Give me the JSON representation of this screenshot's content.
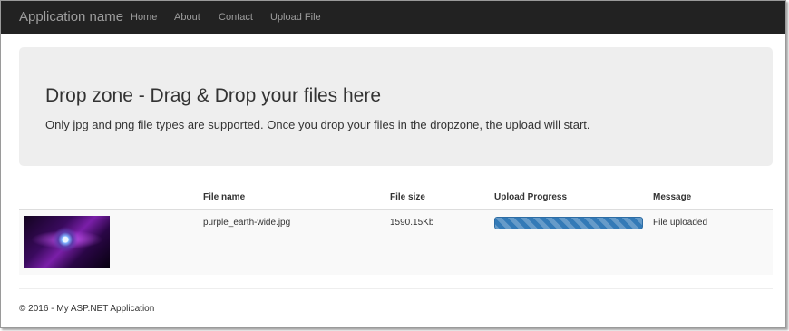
{
  "navbar": {
    "brand": "Application name",
    "links": [
      "Home",
      "About",
      "Contact",
      "Upload File"
    ]
  },
  "jumbotron": {
    "title": "Drop zone - Drag & Drop your files here",
    "lead": "Only jpg and png file types are supported. Once you drop your files in the dropzone, the upload will start."
  },
  "table": {
    "headers": [
      "",
      "File name",
      "File size",
      "Upload Progress",
      "Message"
    ],
    "rows": [
      {
        "thumbnail": "purple-earth-thumbnail",
        "file_name": "purple_earth-wide.jpg",
        "file_size": "1590.15Kb",
        "progress_percent": 100,
        "message": "File uploaded"
      }
    ]
  },
  "footer": {
    "text": "© 2016 - My ASP.NET Application"
  },
  "colors": {
    "navbar_bg": "#222222",
    "jumbotron_bg": "#eeeeee",
    "progress_bar": "#337ab7"
  }
}
